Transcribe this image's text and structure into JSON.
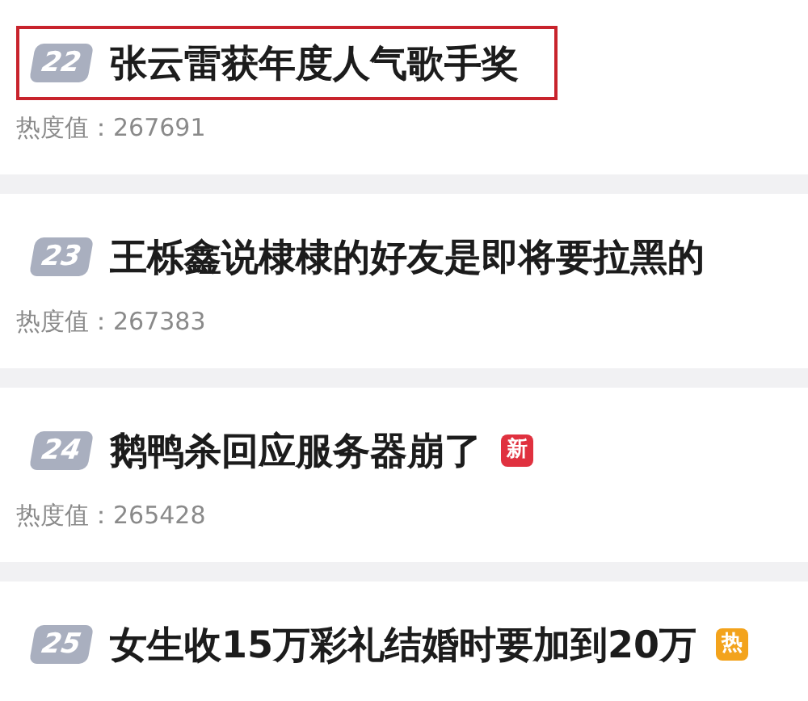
{
  "items": [
    {
      "rank": "22",
      "title": "张云雷获年度人气歌手奖",
      "highlighted": true,
      "heat": "热度值：267691"
    },
    {
      "rank": "23",
      "title": "王栎鑫说棣棣的好友是即将要拉黑的",
      "highlighted": false,
      "heat": "热度值：267383"
    },
    {
      "rank": "24",
      "title": "鹅鸭杀回应服务器崩了",
      "highlighted": false,
      "heat": "热度值：265428",
      "tag": {
        "kind": "new",
        "text": "新"
      }
    },
    {
      "rank": "25",
      "title": "女生收15万彩礼结婚时要加到20万",
      "highlighted": false,
      "tag": {
        "kind": "hot",
        "text": "热"
      }
    }
  ]
}
